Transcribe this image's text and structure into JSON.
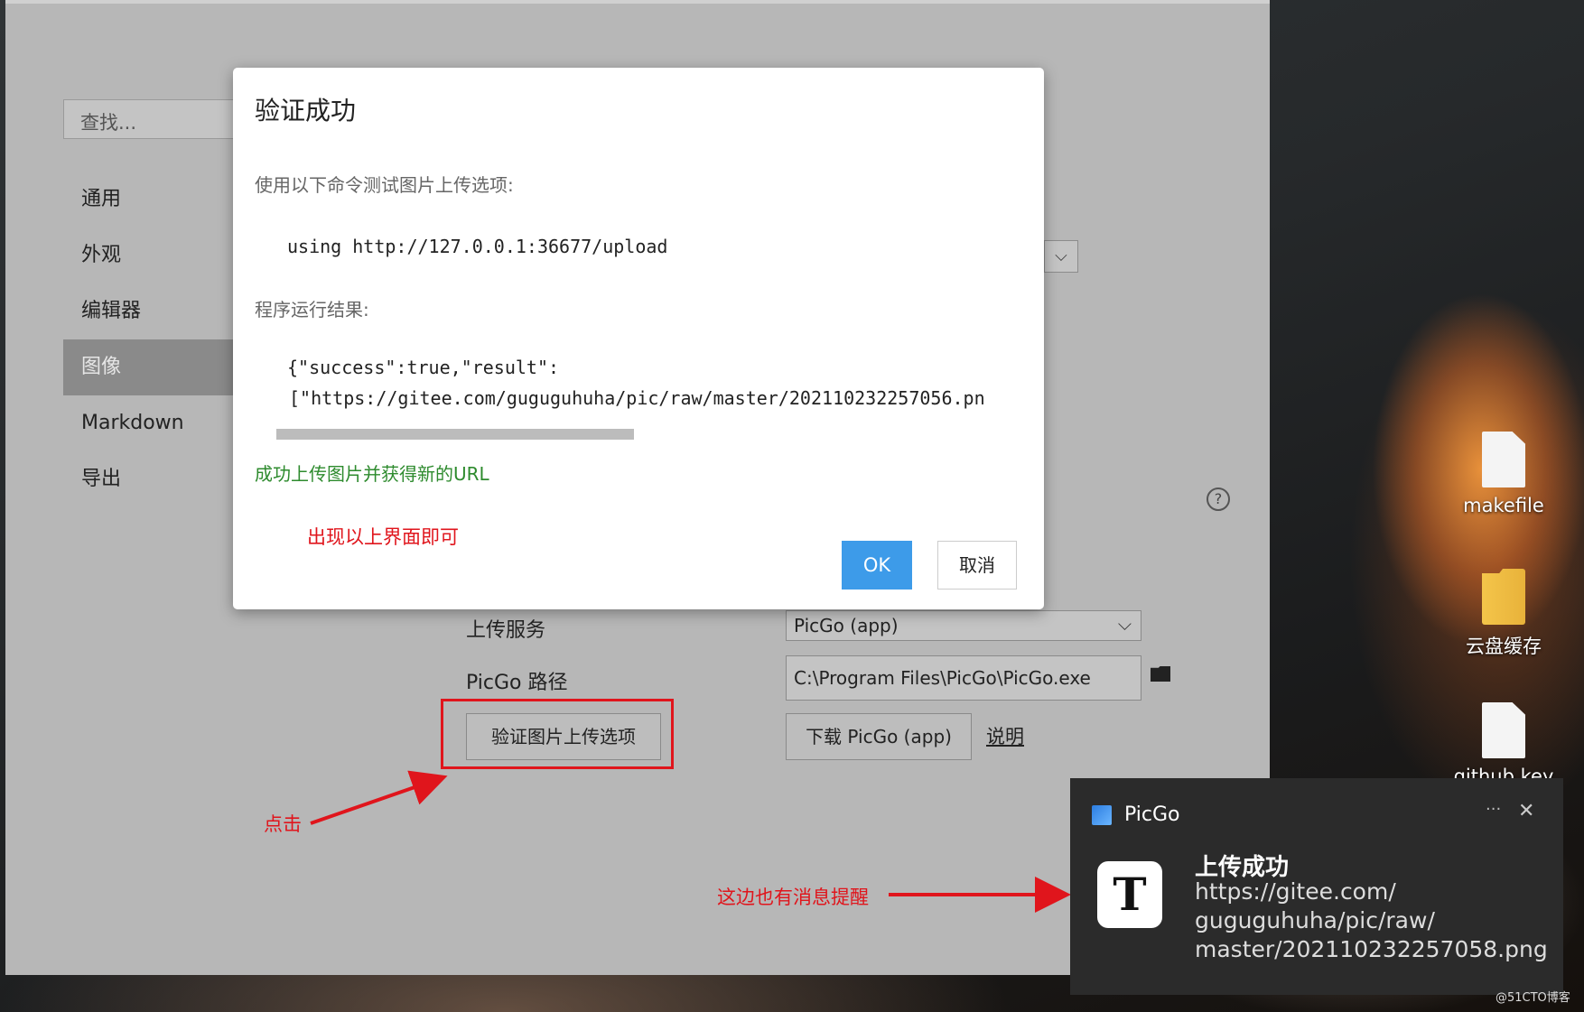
{
  "desktop": {
    "icons": [
      {
        "label": "makefile",
        "icon": "file-icon"
      },
      {
        "label": "云盘缓存",
        "icon": "folder-icon"
      },
      {
        "label": "github.key",
        "icon": "file-icon"
      }
    ]
  },
  "settings": {
    "search_placeholder": "查找...",
    "nav": [
      "通用",
      "外观",
      "编辑器",
      "图像",
      "Markdown",
      "导出"
    ],
    "active_nav": "图像",
    "upload_service_label": "上传服务",
    "upload_service_value": "PicGo (app)",
    "picgo_path_label": "PicGo 路径",
    "picgo_path_value": "C:\\Program Files\\PicGo\\PicGo.exe",
    "verify_button": "验证图片上传选项",
    "download_button": "下载 PicGo (app)",
    "help_link": "说明"
  },
  "dialog": {
    "title": "验证成功",
    "command_intro": "使用以下命令测试图片上传选项:",
    "command": "using http://127.0.0.1:36677/upload",
    "result_intro": "程序运行结果:",
    "result_line1": "{\"success\":true,\"result\":",
    "result_line2": "[\"https://gitee.com/guguguhuha/pic/raw/master/202110232257056.pn",
    "success_message": "成功上传图片并获得新的URL",
    "ok_button": "OK",
    "cancel_button": "取消"
  },
  "annotations": {
    "dialog_note": "出现以上界面即可",
    "click_note": "点击",
    "toast_note": "这边也有消息提醒"
  },
  "toast": {
    "app_name": "PicGo",
    "title": "上传成功",
    "body": "https://gitee.com/guguguhuha/pic/raw/master/202110232257058.png"
  },
  "watermark": "@51CTO博客",
  "colors": {
    "ok_button": "#3d9be9",
    "success_text": "#2e8b2e",
    "annotation_red": "#e0151c"
  }
}
